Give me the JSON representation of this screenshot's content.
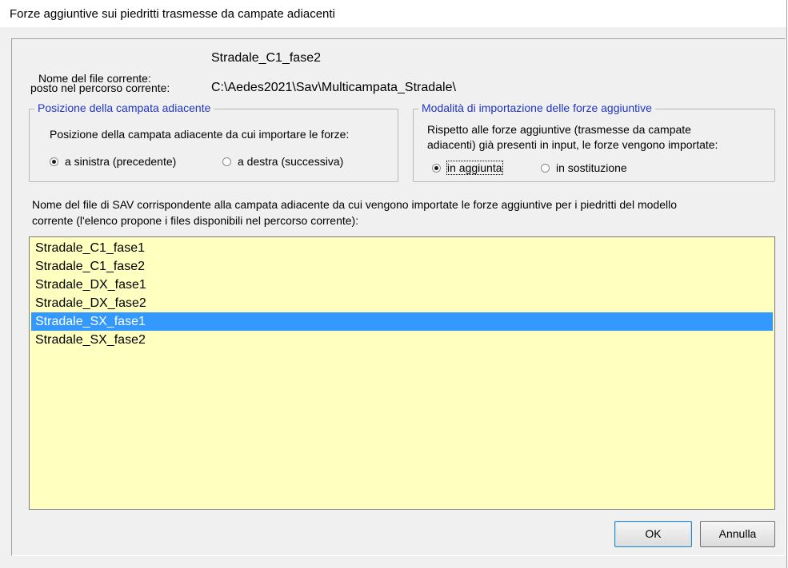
{
  "window": {
    "title": "Forze aggiuntive sui piedritti trasmesse da campate adiacenti"
  },
  "file_info": {
    "name_label": "Nome del file corrente:",
    "name_value": "Stradale_C1_fase2",
    "path_label": "posto nel percorso corrente:",
    "path_value": "C:\\Aedes2021\\Sav\\Multicampata_Stradale\\"
  },
  "position_group": {
    "legend": "Posizione della campata adiacente",
    "description": "Posizione della campata adiacente da cui importare le forze:",
    "options": [
      {
        "label": "a sinistra (precedente)",
        "checked": true
      },
      {
        "label": "a destra (successiva)",
        "checked": false
      }
    ]
  },
  "mode_group": {
    "legend": "Modalità di importazione delle forze aggiuntive",
    "description_line1": "Rispetto alle forze aggiuntive (trasmesse da campate",
    "description_line2": "adiacenti) già presenti in input, le forze vengono importate:",
    "options": [
      {
        "label": "in aggiunta",
        "checked": true
      },
      {
        "label": "in sostituzione",
        "checked": false
      }
    ]
  },
  "file_list": {
    "description_line1": "Nome del file di SAV corrispondente alla campata adiacente da cui vengono importate le forze aggiuntive per i piedritti del modello",
    "description_line2": "corrente (l'elenco propone i files disponibili nel percorso corrente):",
    "items": [
      "Stradale_C1_fase1",
      "Stradale_C1_fase2",
      "Stradale_DX_fase1",
      "Stradale_DX_fase2",
      "Stradale_SX_fase1",
      "Stradale_SX_fase2"
    ],
    "selected_item": "Stradale_SX_fase1"
  },
  "buttons": {
    "ok": "OK",
    "cancel": "Annulla"
  },
  "colors": {
    "legend_text": "#1f35c2",
    "listbox_bg": "#ffffc0",
    "selection_bg": "#3399ff"
  }
}
